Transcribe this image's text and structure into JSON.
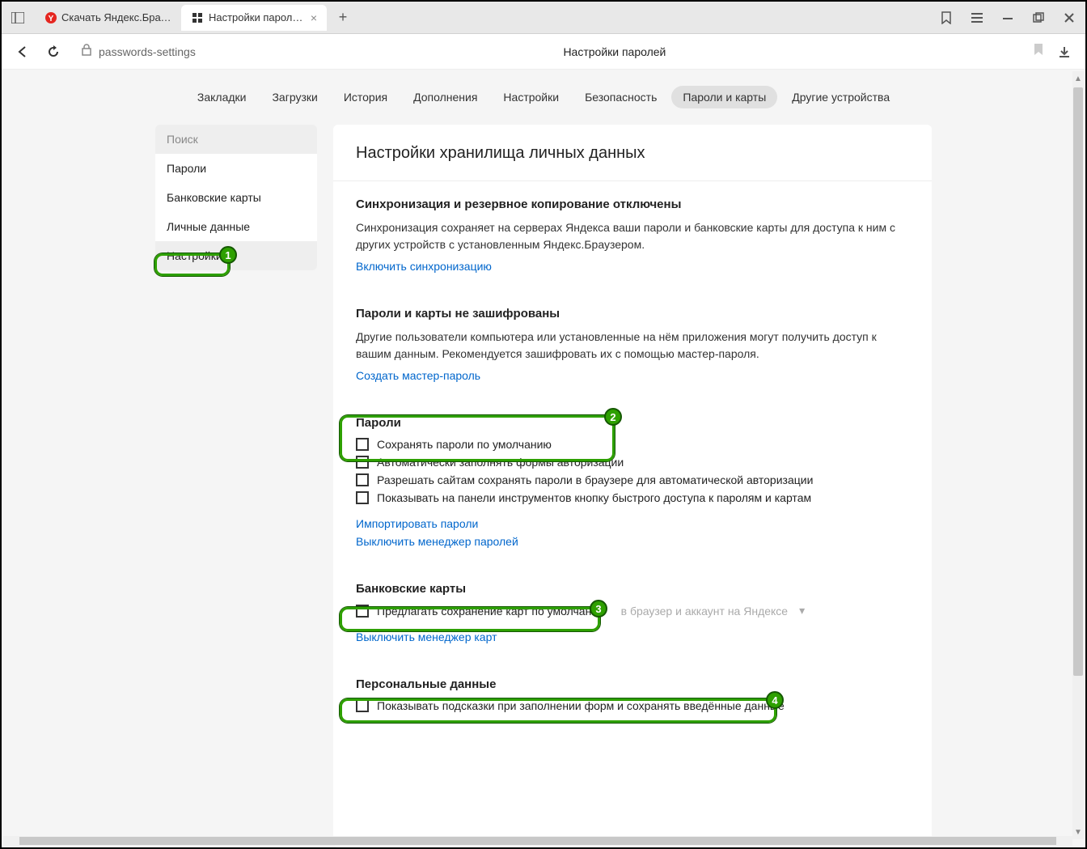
{
  "titlebar": {
    "tabs": [
      {
        "label": "Скачать Яндекс.Браузер д"
      },
      {
        "label": "Настройки паролей"
      }
    ]
  },
  "addrbar": {
    "url": "passwords-settings",
    "title": "Настройки паролей"
  },
  "topnav": {
    "items": [
      "Закладки",
      "Загрузки",
      "История",
      "Дополнения",
      "Настройки",
      "Безопасность",
      "Пароли и карты",
      "Другие устройства"
    ],
    "active": 6
  },
  "sidebar": {
    "search_placeholder": "Поиск",
    "items": [
      "Пароли",
      "Банковские карты",
      "Личные данные",
      "Настройки"
    ],
    "active": 3
  },
  "page": {
    "title": "Настройки хранилища личных данных",
    "sync": {
      "heading": "Синхронизация и резервное копирование отключены",
      "text": "Синхронизация сохраняет на серверах Яндекса ваши пароли и банковские карты для доступа к ним с других устройств с установленным Яндекс.Браузером.",
      "link": "Включить синхронизацию"
    },
    "encrypt": {
      "heading": "Пароли и карты не зашифрованы",
      "text": "Другие пользователи компьютера или установленные на нём приложения могут получить доступ к вашим данным. Рекомендуется зашифровать их с помощью мастер-пароля.",
      "link": "Создать мастер-пароль"
    },
    "passwords": {
      "heading": "Пароли",
      "opt1": "Сохранять пароли по умолчанию",
      "opt2": "Автоматически заполнять формы авторизации",
      "opt3": "Разрешать сайтам сохранять пароли в браузере для автоматической авторизации",
      "opt4": "Показывать на панели инструментов кнопку быстрого доступа к паролям и картам",
      "link1": "Импортировать пароли",
      "link2": "Выключить менеджер паролей"
    },
    "cards": {
      "heading": "Банковские карты",
      "opt1": "Предлагать сохранение карт по умолчанию",
      "hint": "в браузер и аккаунт на Яндексе",
      "link": "Выключить менеджер карт"
    },
    "personal": {
      "heading": "Персональные данные",
      "opt1": "Показывать подсказки при заполнении форм и сохранять введённые данные"
    }
  },
  "callouts": {
    "c1": "1",
    "c2": "2",
    "c3": "3",
    "c4": "4"
  }
}
